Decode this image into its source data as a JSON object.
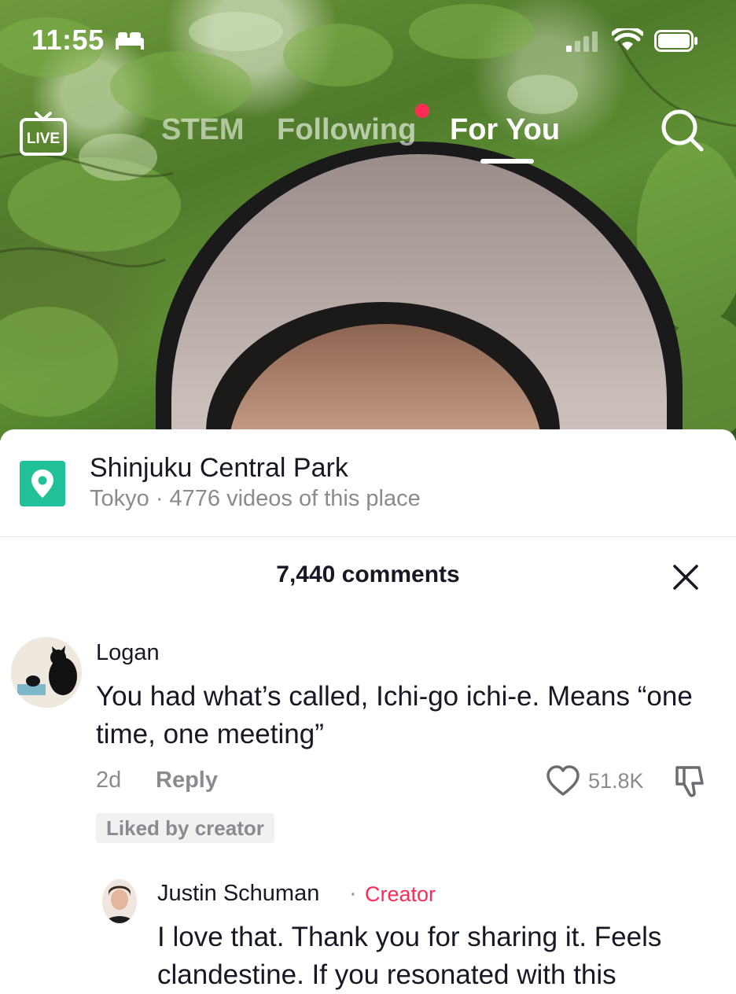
{
  "status_bar": {
    "time": "11:55"
  },
  "top_nav": {
    "live_label": "LIVE",
    "tabs": [
      "STEM",
      "Following",
      "For You"
    ],
    "active_tab": "For You"
  },
  "location": {
    "name": "Shinjuku Central Park",
    "subtitle": "Tokyo · 4776 videos of this place"
  },
  "comments": {
    "count_label": "7,440 comments",
    "items": [
      {
        "author": "Logan",
        "text": "You had what’s called, Ichi-go ichi-e. Means “one time, one meeting”",
        "age": "2d",
        "reply_label": "Reply",
        "likes": "51.8K",
        "badge": "Liked by creator"
      }
    ],
    "reply": {
      "author": "Justin Schuman",
      "separator": "·",
      "role": "Creator",
      "text": "I love that. Thank you for sharing it. Feels clandestine. If you resonated with this"
    }
  },
  "colors": {
    "accent": "#fe2c55",
    "pin": "#20c198",
    "text": "#161823",
    "muted": "#8a8b91"
  },
  "icons": [
    "bed-icon",
    "signal-icon",
    "wifi-icon",
    "battery-icon",
    "live-tv-icon",
    "search-icon",
    "location-pin-icon",
    "close-icon",
    "heart-icon",
    "dislike-icon"
  ]
}
